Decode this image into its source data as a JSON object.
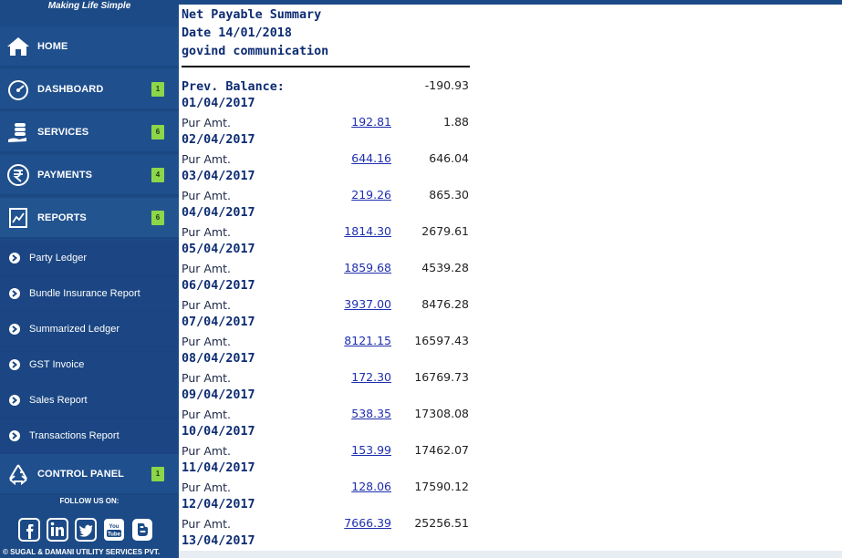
{
  "sidebar": {
    "tagline": "Making Life Simple",
    "main_items": [
      {
        "label": "HOME",
        "icon": "home-icon",
        "badge": ""
      },
      {
        "label": "DASHBOARD",
        "icon": "speedometer-icon",
        "badge": "1"
      },
      {
        "label": "SERVICES",
        "icon": "coins-hand-icon",
        "badge": "6"
      },
      {
        "label": "PAYMENTS",
        "icon": "rupee-icon",
        "badge": "4"
      },
      {
        "label": "REPORTS",
        "icon": "report-chart-icon",
        "badge": "6"
      }
    ],
    "report_items": [
      {
        "label": "Party Ledger"
      },
      {
        "label": "Bundle Insurance Report"
      },
      {
        "label": "Summarized Ledger"
      },
      {
        "label": "GST Invoice"
      },
      {
        "label": "Sales Report"
      },
      {
        "label": "Transactions Report"
      }
    ],
    "control_panel": {
      "label": "CONTROL PANEL",
      "icon": "recycle-icon",
      "badge": "1"
    },
    "follow_label": "FOLLOW US ON:",
    "social": [
      "facebook-icon",
      "linkedin-icon",
      "twitter-icon",
      "youtube-icon",
      "blogger-icon"
    ],
    "copyright": "© SUGAL & DAMANI UTILITY SERVICES PVT."
  },
  "summary": {
    "title": "Net Payable Summary",
    "date_line": "Date 14/01/2018",
    "party": "govind communication",
    "prev_balance_label": "Prev. Balance:",
    "prev_balance_value": "-190.93",
    "pur_label": "Pur Amt.",
    "entries": [
      {
        "date": "01/04/2017",
        "amount": "192.81",
        "balance": "1.88"
      },
      {
        "date": "02/04/2017",
        "amount": "644.16",
        "balance": "646.04"
      },
      {
        "date": "03/04/2017",
        "amount": "219.26",
        "balance": "865.30"
      },
      {
        "date": "04/04/2017",
        "amount": "1814.30",
        "balance": "2679.61"
      },
      {
        "date": "05/04/2017",
        "amount": "1859.68",
        "balance": "4539.28"
      },
      {
        "date": "06/04/2017",
        "amount": "3937.00",
        "balance": "8476.28"
      },
      {
        "date": "07/04/2017",
        "amount": "8121.15",
        "balance": "16597.43"
      },
      {
        "date": "08/04/2017",
        "amount": "172.30",
        "balance": "16769.73"
      },
      {
        "date": "09/04/2017",
        "amount": "538.35",
        "balance": "17308.08"
      },
      {
        "date": "10/04/2017",
        "amount": "153.99",
        "balance": "17462.07"
      },
      {
        "date": "11/04/2017",
        "amount": "128.06",
        "balance": "17590.12"
      },
      {
        "date": "12/04/2017",
        "amount": "7666.39",
        "balance": "25256.51"
      }
    ],
    "trailing_date": "13/04/2017"
  },
  "colors": {
    "sidebar": "#1c4a86",
    "badge": "#8cd64a",
    "heading": "#0d2c73",
    "link": "#1f2fb0"
  }
}
